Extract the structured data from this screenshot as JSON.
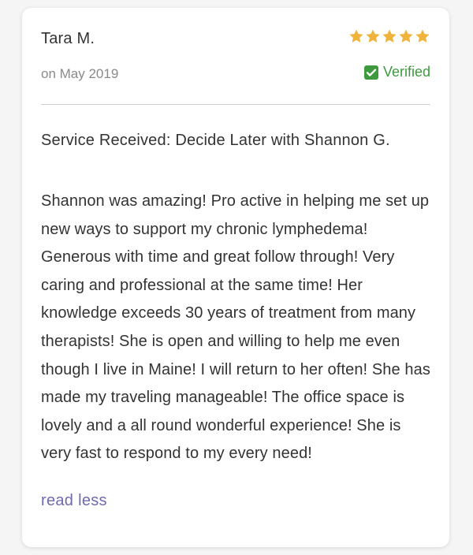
{
  "review": {
    "reviewer_name": "Tara M.",
    "rating": 5,
    "rating_max": 5,
    "date": "on May 2019",
    "verified_label": "Verified",
    "service": "Service Received: Decide Later with Shannon G.",
    "text": "Shannon was amazing! Pro active in helping me set up new ways to support my chronic lymphedema! Generous with time and great follow through! Very caring and professional at the same time! Her knowledge exceeds 30 years of treatment from many therapists! She is open and willing to help me even though I live in Maine! I will return to her often! She has made my traveling manageable! The office space is lovely and a all round wonderful experience! She is very fast to respond to my every need!",
    "read_less_label": "read less"
  },
  "colors": {
    "star": "#f0b43c",
    "verified": "#3d9a3d",
    "link": "#6f6ab0",
    "text": "#333333",
    "muted": "#8a8a8a"
  },
  "icons": {
    "star": "star-icon",
    "verified": "checkbox-checked-icon"
  }
}
